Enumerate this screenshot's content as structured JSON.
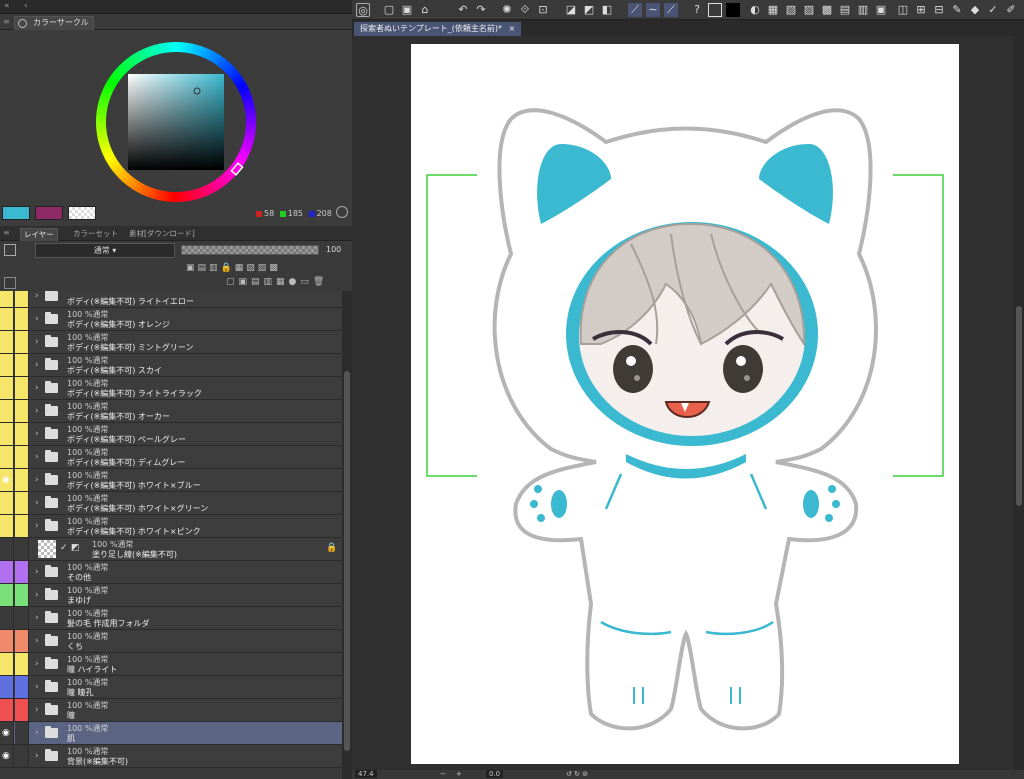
{
  "left_top": {
    "collapse": "«",
    "arrow": "‹"
  },
  "color_circle": {
    "tab_label": "カラーサークル",
    "rgb": {
      "r": "58",
      "g": "185",
      "b": "208"
    },
    "main_color": "#3ab9d0",
    "sub_color": "#8e2a66"
  },
  "layer_tabs": {
    "layer": "レイヤー",
    "colorset": "カラーセット",
    "material": "素材[ダウンロード]"
  },
  "layer_props": {
    "blend": "通常",
    "opacity": "100"
  },
  "layers": [
    {
      "l1": "",
      "l2": "ボディ(※編集不可) ライトイエロー",
      "c1": "#f5e66a",
      "c2": "#f5e66a"
    },
    {
      "l1": "100 %通常",
      "l2": "ボディ(※編集不可) オレンジ",
      "c1": "#f5e66a",
      "c2": "#f5e66a"
    },
    {
      "l1": "100 %通常",
      "l2": "ボディ(※編集不可) ミントグリーン",
      "c1": "#f5e66a",
      "c2": "#f5e66a"
    },
    {
      "l1": "100 %通常",
      "l2": "ボディ(※編集不可) スカイ",
      "c1": "#f5e66a",
      "c2": "#f5e66a"
    },
    {
      "l1": "100 %通常",
      "l2": "ボディ(※編集不可) ライトライラック",
      "c1": "#f5e66a",
      "c2": "#f5e66a"
    },
    {
      "l1": "100 %通常",
      "l2": "ボディ(※編集不可) オーカー",
      "c1": "#f5e66a",
      "c2": "#f5e66a"
    },
    {
      "l1": "100 %通常",
      "l2": "ボディ(※編集不可) ペールグレー",
      "c1": "#f5e66a",
      "c2": "#f5e66a"
    },
    {
      "l1": "100 %通常",
      "l2": "ボディ(※編集不可) ディムグレー",
      "c1": "#f5e66a",
      "c2": "#f5e66a"
    },
    {
      "l1": "100 %通常",
      "l2": "ボディ(※編集不可) ホワイト×ブルー",
      "c1": "#f5e66a",
      "c2": "#f5e66a",
      "eye": true
    },
    {
      "l1": "100 %通常",
      "l2": "ボディ(※編集不可) ホワイト×グリーン",
      "c1": "#f5e66a",
      "c2": "#f5e66a"
    },
    {
      "l1": "100 %通常",
      "l2": "ボディ(※編集不可) ホワイト×ピンク",
      "c1": "#f5e66a",
      "c2": "#f5e66a"
    },
    {
      "l1": "100 %通常",
      "l2": "塗り足し線(※編集不可)",
      "c1": "#3a3a3a",
      "c2": "#3a3a3a",
      "raster": true
    },
    {
      "l1": "100 %通常",
      "l2": "その他",
      "c1": "#b070f0",
      "c2": "#b070f0"
    },
    {
      "l1": "100 %通常",
      "l2": "まゆげ",
      "c1": "#7ae07a",
      "c2": "#7ae07a"
    },
    {
      "l1": "100 %通常",
      "l2": "髪の毛 作成用フォルダ",
      "c1": "#3a3a3a",
      "c2": "#3a3a3a"
    },
    {
      "l1": "100 %通常",
      "l2": "くち",
      "c1": "#f08a6a",
      "c2": "#f08a6a"
    },
    {
      "l1": "100 %通常",
      "l2": "瞳 ハイライト",
      "c1": "#f5e66a",
      "c2": "#f5e66a"
    },
    {
      "l1": "100 %通常",
      "l2": "瞳 瞳孔",
      "c1": "#6070e0",
      "c2": "#6070e0"
    },
    {
      "l1": "100 %通常",
      "l2": "瞳",
      "c1": "#f05050",
      "c2": "#f05050"
    },
    {
      "l1": "100 %通常",
      "l2": "肌",
      "c1": "#3a3a3a",
      "c2": "#3a3a3a",
      "sel": true,
      "eye": true
    },
    {
      "l1": "100 %通常",
      "l2": "背景(※編集不可)",
      "c1": "#3a3a3a",
      "c2": "#3a3a3a",
      "eye": true
    }
  ],
  "document": {
    "tab_title": "探索者ぬいテンプレート_(依頼主名前)*",
    "close": "×"
  },
  "status": {
    "zoom": "47.4",
    "angle": "0.0"
  },
  "colors": {
    "accent": "#3ab9d0",
    "guide": "#3cd23c",
    "outline": "#b5b5b5"
  }
}
